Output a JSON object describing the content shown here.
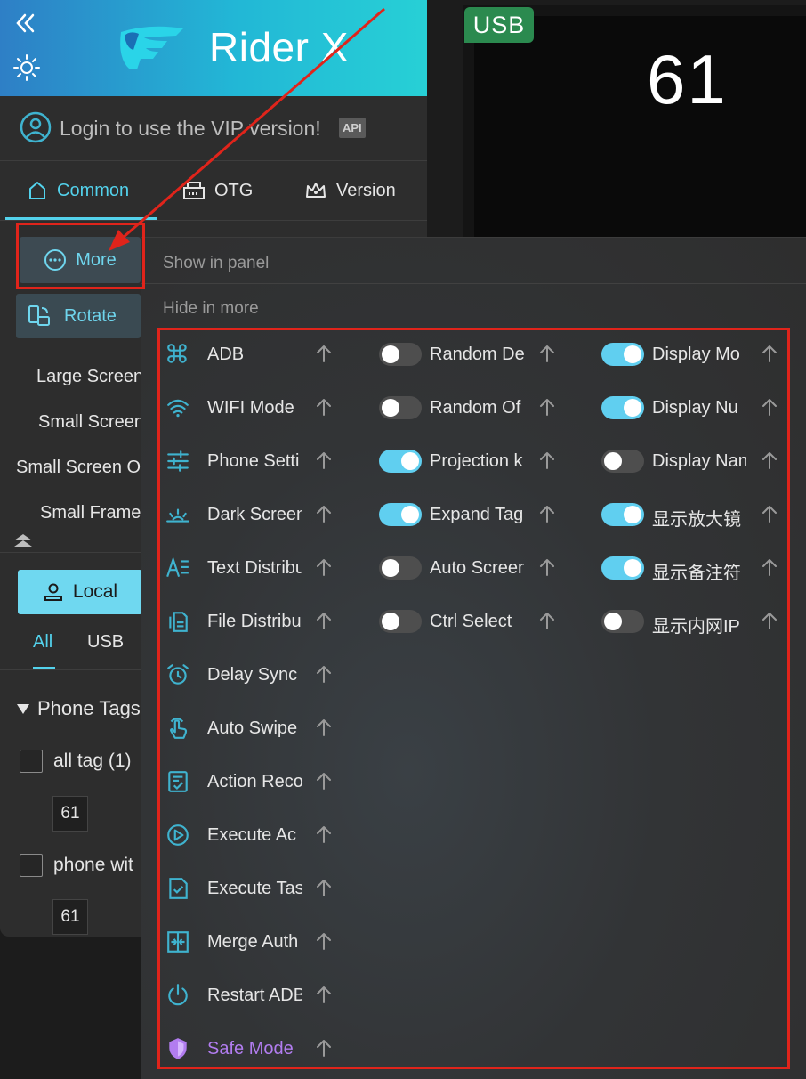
{
  "app": {
    "title": "Rider X"
  },
  "login": {
    "text": "Login to use the VIP version!",
    "api_badge": "API"
  },
  "tabs": [
    {
      "label": "Common",
      "active": true
    },
    {
      "label": "OTG",
      "active": false
    },
    {
      "label": "Version",
      "active": false
    }
  ],
  "sidebar": {
    "more_label": "More",
    "rotate_label": "Rotate",
    "items": [
      "Large Screen",
      "Small Screen",
      "Small Screen O",
      "Small Frame"
    ],
    "local_label": "Local",
    "sub_tabs": [
      {
        "label": "All",
        "active": true
      },
      {
        "label": "USB",
        "active": false
      }
    ],
    "phone_tags_heading": "Phone Tags",
    "tags": [
      {
        "label": "all tag (1)",
        "device": "61"
      },
      {
        "label": "phone wit",
        "device": "61"
      }
    ]
  },
  "device": {
    "badge": "USB",
    "number": "61"
  },
  "popup": {
    "show_in_panel": "Show in panel",
    "hide_in_more": "Hide in more",
    "col1": [
      {
        "label": "ADB",
        "icon": "command-icon"
      },
      {
        "label": "WIFI Mode",
        "icon": "wifi-icon"
      },
      {
        "label": "Phone Setti",
        "icon": "sliders-icon"
      },
      {
        "label": "Dark Screen",
        "icon": "sunrise-icon"
      },
      {
        "label": "Text Distribu",
        "icon": "text-align-icon"
      },
      {
        "label": "File Distribu",
        "icon": "files-icon"
      },
      {
        "label": "Delay Sync",
        "icon": "alarm-clock-icon"
      },
      {
        "label": "Auto Swipe",
        "icon": "tap-hand-icon"
      },
      {
        "label": "Action Reco",
        "icon": "checklist-icon"
      },
      {
        "label": "Execute Ac",
        "icon": "play-circle-icon"
      },
      {
        "label": "Execute Tas",
        "icon": "file-check-icon"
      },
      {
        "label": "Merge Auth",
        "icon": "merge-frame-icon"
      },
      {
        "label": "Restart ADB",
        "icon": "power-icon"
      },
      {
        "label": "Safe Mode",
        "icon": "shield-icon",
        "accent": "#b27df0"
      }
    ],
    "col2": [
      {
        "label": "Random De",
        "on": false
      },
      {
        "label": "Random Of",
        "on": false
      },
      {
        "label": "Projection k",
        "on": true
      },
      {
        "label": "Expand Tag",
        "on": true
      },
      {
        "label": "Auto Screen",
        "on": false
      },
      {
        "label": "Ctrl Select",
        "on": false
      }
    ],
    "col3": [
      {
        "label": "Display Mo",
        "on": true
      },
      {
        "label": "Display Nu",
        "on": true
      },
      {
        "label": "Display Nam",
        "on": false
      },
      {
        "label": "显示放大镜",
        "on": true
      },
      {
        "label": "显示备注符",
        "on": true
      },
      {
        "label": "显示内网IP",
        "on": false
      }
    ]
  },
  "colors": {
    "accent": "#53d2ec",
    "toggle_on": "#60cff0",
    "annotation": "#e0241b"
  }
}
